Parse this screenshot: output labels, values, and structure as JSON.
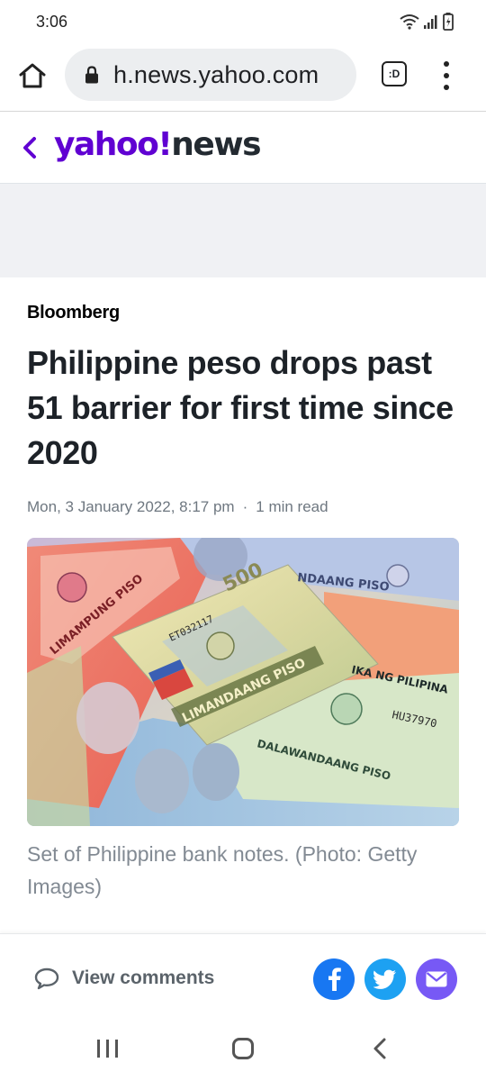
{
  "status_bar": {
    "time": "3:06",
    "icons": [
      "wifi-icon",
      "signal-icon",
      "battery-icon"
    ]
  },
  "browser": {
    "url": "h.news.yahoo.com",
    "tabs_label": ":D",
    "icons": [
      "home-icon",
      "lock-icon",
      "tabs-icon",
      "more-vert-icon"
    ]
  },
  "yahoo_header": {
    "brand_yahoo": "yahoo!",
    "brand_news": "news",
    "back_icon": "chevron-left-icon",
    "brand_color": "#6001d2"
  },
  "article": {
    "source": "Bloomberg",
    "headline": "Philippine peso drops past 51 barrier for first time since 2020",
    "date": "Mon, 3 January 2022, 8:17 pm",
    "separator": "·",
    "read_time": "1 min read",
    "caption": "Set of Philippine bank notes. (Photo: Getty Images)"
  },
  "photo": {
    "note_texts": [
      "LIMAMPUNG PISO",
      "500",
      "LIMANDAANG PISO",
      "NDAANG PISO",
      "DALAWANDAANG PISO",
      "IKA NG PILIPINA",
      "ET032117",
      "HU37970"
    ]
  },
  "share_bar": {
    "comments_label": "View comments",
    "facebook_color": "#1877f2",
    "twitter_color": "#1da1f2",
    "mail_color": "#7759f5"
  }
}
